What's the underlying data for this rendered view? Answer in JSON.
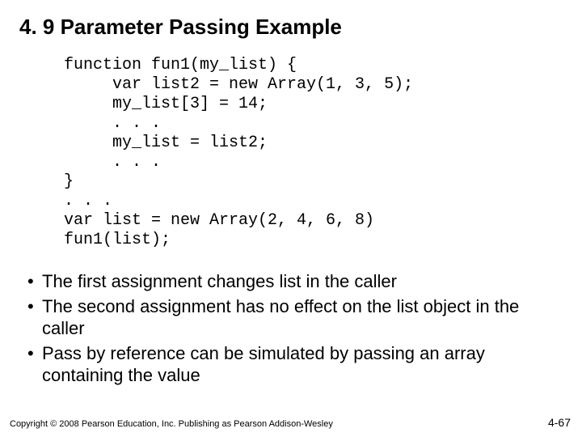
{
  "title": "4. 9 Parameter Passing Example",
  "code": "function fun1(my_list) {\n     var list2 = new Array(1, 3, 5);\n     my_list[3] = 14;\n     . . .\n     my_list = list2;\n     . . .\n}\n. . .\nvar list = new Array(2, 4, 6, 8)\nfun1(list);",
  "bullets": [
    "The first assignment changes list in the caller",
    "The second assignment has no effect on the list object in the caller",
    "Pass by reference can be simulated by passing an array containing the value"
  ],
  "footer": "Copyright © 2008 Pearson Education, Inc. Publishing as Pearson Addison-Wesley",
  "pagenum": "4-67"
}
